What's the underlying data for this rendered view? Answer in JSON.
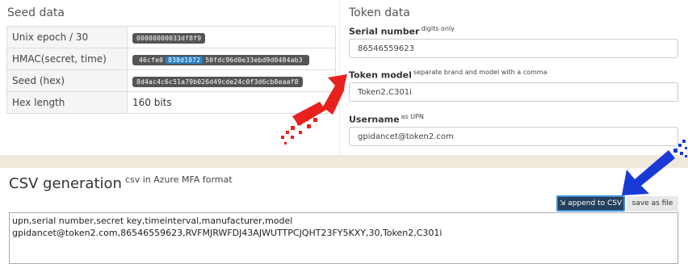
{
  "seed": {
    "title": "Seed data",
    "rows": [
      {
        "key": "Unix epoch / 30",
        "value": "00000000033df8f9"
      },
      {
        "key": "HMAC(secret, time)",
        "value_parts": [
          "46cfe0",
          "838d1072",
          "50fdc96d0e33ebd9d0484ab3"
        ]
      },
      {
        "key": "Seed (hex)",
        "value": "8d4ac4c6c51a79b026d49cde24c0f3d6cb8eaaf8"
      },
      {
        "key": "Hex length",
        "value": "160 bits"
      }
    ]
  },
  "token": {
    "title": "Token data",
    "serial": {
      "label": "Serial number",
      "hint": "digits only",
      "value": "86546559623"
    },
    "model": {
      "label": "Token model",
      "hint": "separate brand and model with a comma",
      "value": "Token2,C301i"
    },
    "username": {
      "label": "Username",
      "hint": "as UPN",
      "value": "gpidancet@token2.com"
    }
  },
  "csv": {
    "title": "CSV generation",
    "subtitle": "csv in Azure MFA format",
    "append_label": "append to CSV",
    "save_label": "save as file",
    "content": "upn,serial number,secret key,timeinterval,manufacturer,model\ngpidancet@token2.com,86546559623,RVFMJRWFDJ43AJWUTTPCJQHT23FY5KXY,30,Token2,C301i"
  },
  "colors": {
    "red_arrow": "#e8201e",
    "blue_arrow": "#1a3ad8",
    "append_bg": "#25405d"
  }
}
